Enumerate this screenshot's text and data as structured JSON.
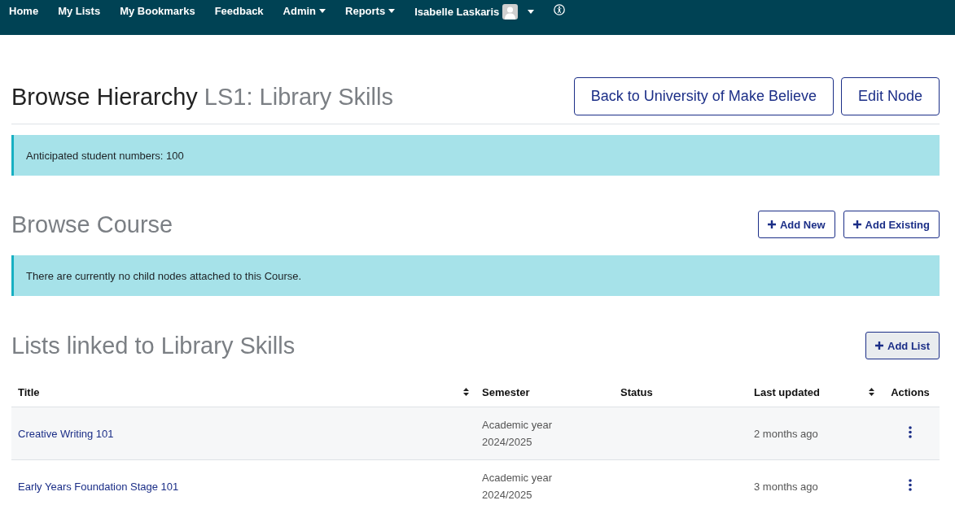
{
  "navbar": {
    "items": [
      {
        "kind": "link",
        "label": "Home"
      },
      {
        "kind": "link",
        "label": "My Lists"
      },
      {
        "kind": "link",
        "label": "My Bookmarks"
      },
      {
        "kind": "link",
        "label": "Feedback"
      },
      {
        "kind": "dropdown",
        "label": "Admin"
      },
      {
        "kind": "dropdown",
        "label": "Reports"
      },
      {
        "kind": "user",
        "label": "Isabelle Laskaris"
      },
      {
        "kind": "accessibility"
      }
    ]
  },
  "header": {
    "title": "Browse Hierarchy",
    "subtitle": "LS1: Library Skills",
    "buttons": [
      "Back to University of Make Believe",
      "Edit Node"
    ]
  },
  "info_alert": "Anticipated student numbers: 100",
  "course_section": {
    "heading": "Browse Course",
    "buttons": [
      "Add New",
      "Add Existing"
    ],
    "alert": "There are currently no child nodes attached to this Course."
  },
  "lists_section": {
    "heading": "Lists linked to Library Skills",
    "button": "Add List",
    "table": {
      "columns": [
        {
          "label": "Title",
          "sortable": true
        },
        {
          "label": "Semester",
          "sortable": false
        },
        {
          "label": "Status",
          "sortable": false
        },
        {
          "label": "Last updated",
          "sortable": true
        },
        {
          "label": "Actions",
          "sortable": false
        }
      ],
      "rows": [
        {
          "title": "Creative Writing 101",
          "semester": "Academic year 2024/2025",
          "last_updated": "2 months ago"
        },
        {
          "title": "Early Years Foundation Stage 101",
          "semester": "Academic year 2024/2025",
          "last_updated": "3 months ago"
        }
      ]
    }
  }
}
